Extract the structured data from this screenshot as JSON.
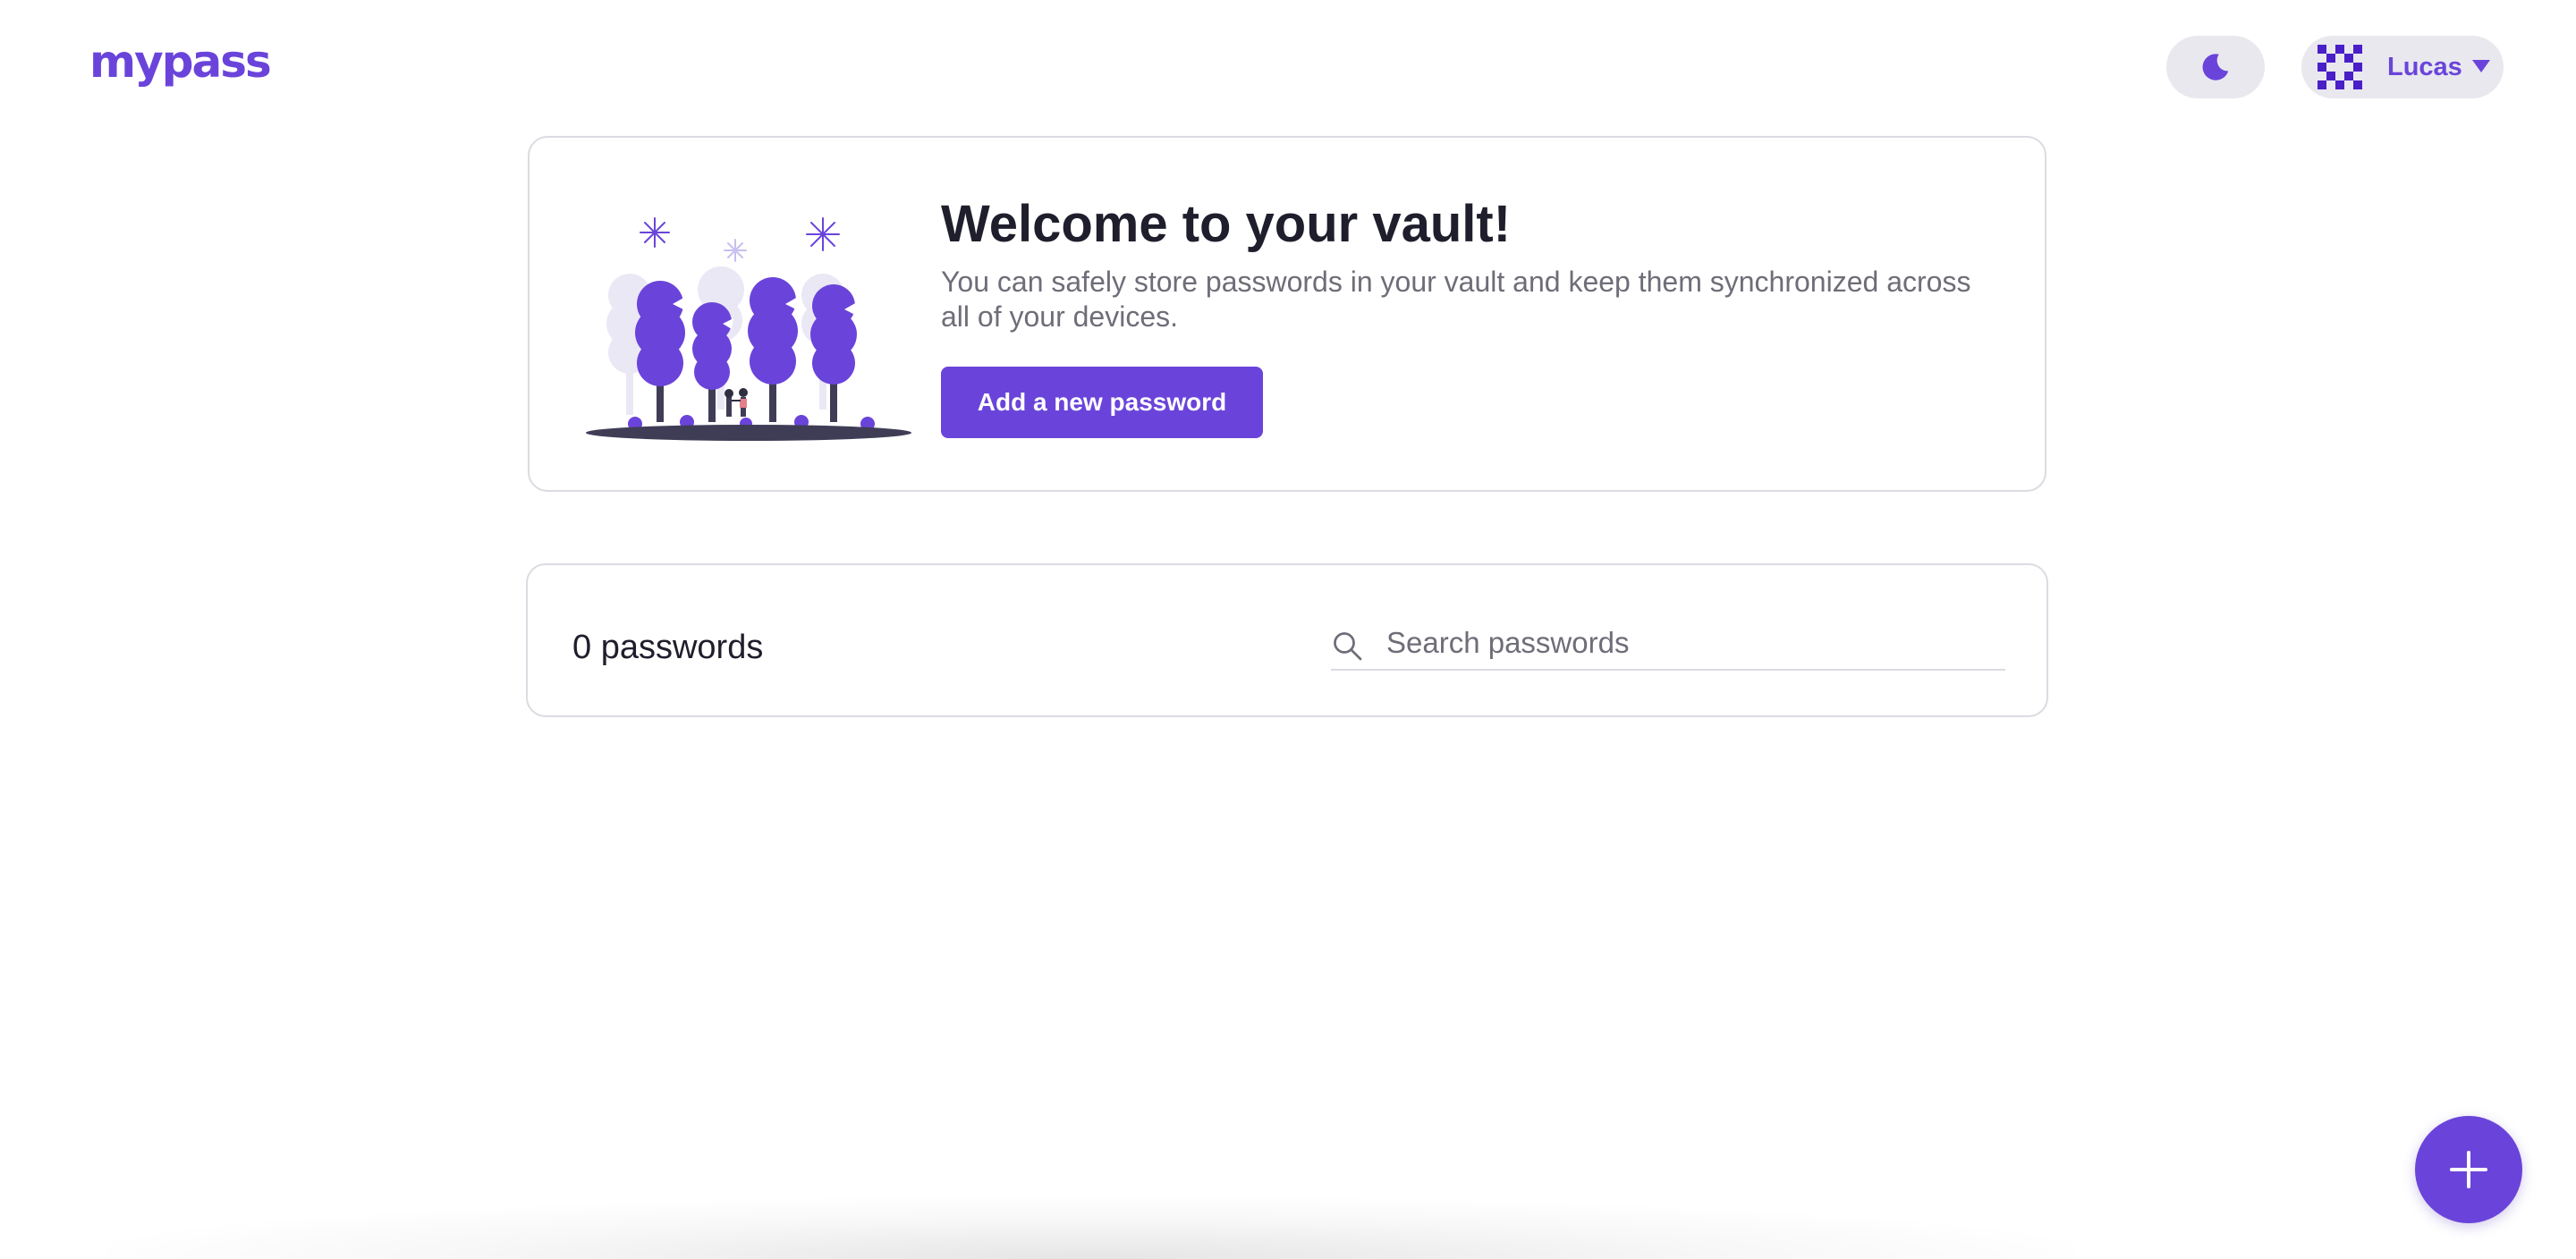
{
  "app": {
    "logo_text": "mypass"
  },
  "header": {
    "theme_toggle_icon": "moon-icon",
    "user": {
      "name": "Lucas",
      "avatar_icon": "pixel-avatar-icon",
      "menu_icon": "caret-down-icon"
    }
  },
  "welcome": {
    "title": "Welcome to your vault!",
    "description": "You can safely store passwords in your vault and keep them synchronized across all of your devices.",
    "button_label": "Add a new password",
    "illustration": "celebration-trees-illustration"
  },
  "passwords": {
    "count_label": "0 passwords",
    "search": {
      "placeholder": "Search passwords",
      "value": "",
      "icon": "search-icon"
    }
  },
  "fab": {
    "icon": "plus-icon"
  },
  "colors": {
    "accent": "#6a44da",
    "pill_background": "#e8e8ee",
    "border": "#dcdbe2",
    "text_primary": "#1f1e2c",
    "text_secondary": "#6e6d78",
    "tree_light": "#ebe8f5",
    "ground": "#3f3d56"
  }
}
